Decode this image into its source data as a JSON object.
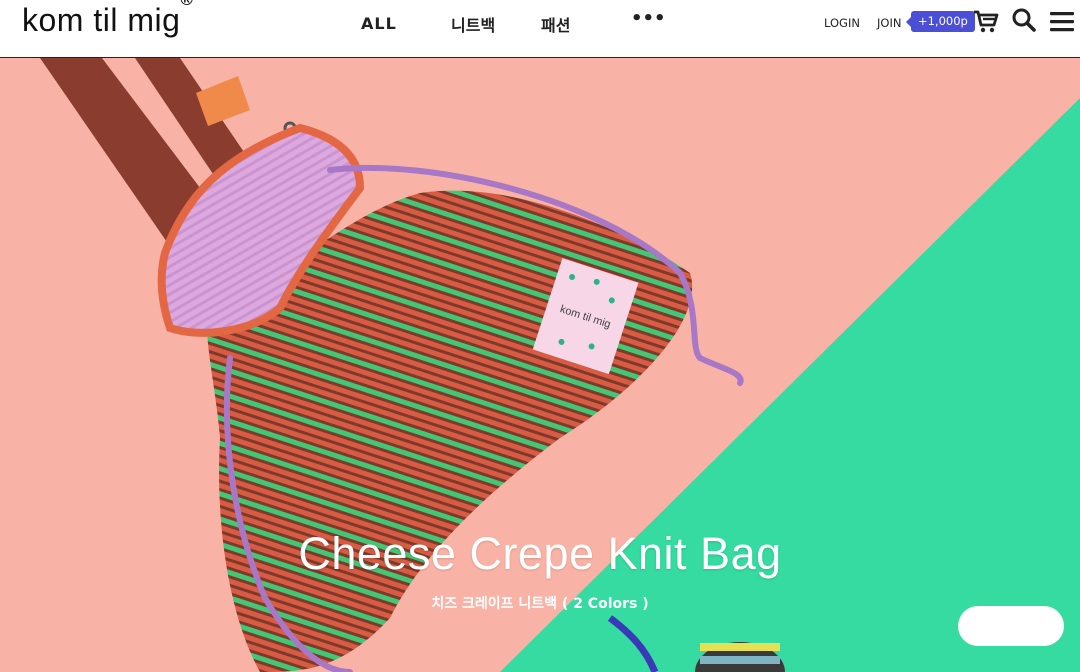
{
  "header": {
    "logo_text": "kom til mig",
    "logo_mark": "®",
    "nav": [
      {
        "label": "ALL"
      },
      {
        "label": "니트백"
      },
      {
        "label": "패션"
      },
      {
        "label": "•••"
      }
    ],
    "login_label": "LOGIN",
    "join_label": "JOIN",
    "join_badge": "+1,000p",
    "icons": [
      "cart-icon",
      "search-icon",
      "menu-icon"
    ]
  },
  "hero": {
    "title": "Cheese Crepe Knit Bag",
    "subtitle": "치즈 크레이프 니트백 ( 2 Colors )",
    "colors": {
      "background_pink": "#f8b3a6",
      "background_green": "#35dba0",
      "strap": "#8a3d2e",
      "ruffle": "#dba9e0",
      "stripe_red": "#d85b43",
      "stripe_green": "#43c774",
      "stripe_brown": "#7d3a2b"
    },
    "tag_text": "kom til mig"
  }
}
